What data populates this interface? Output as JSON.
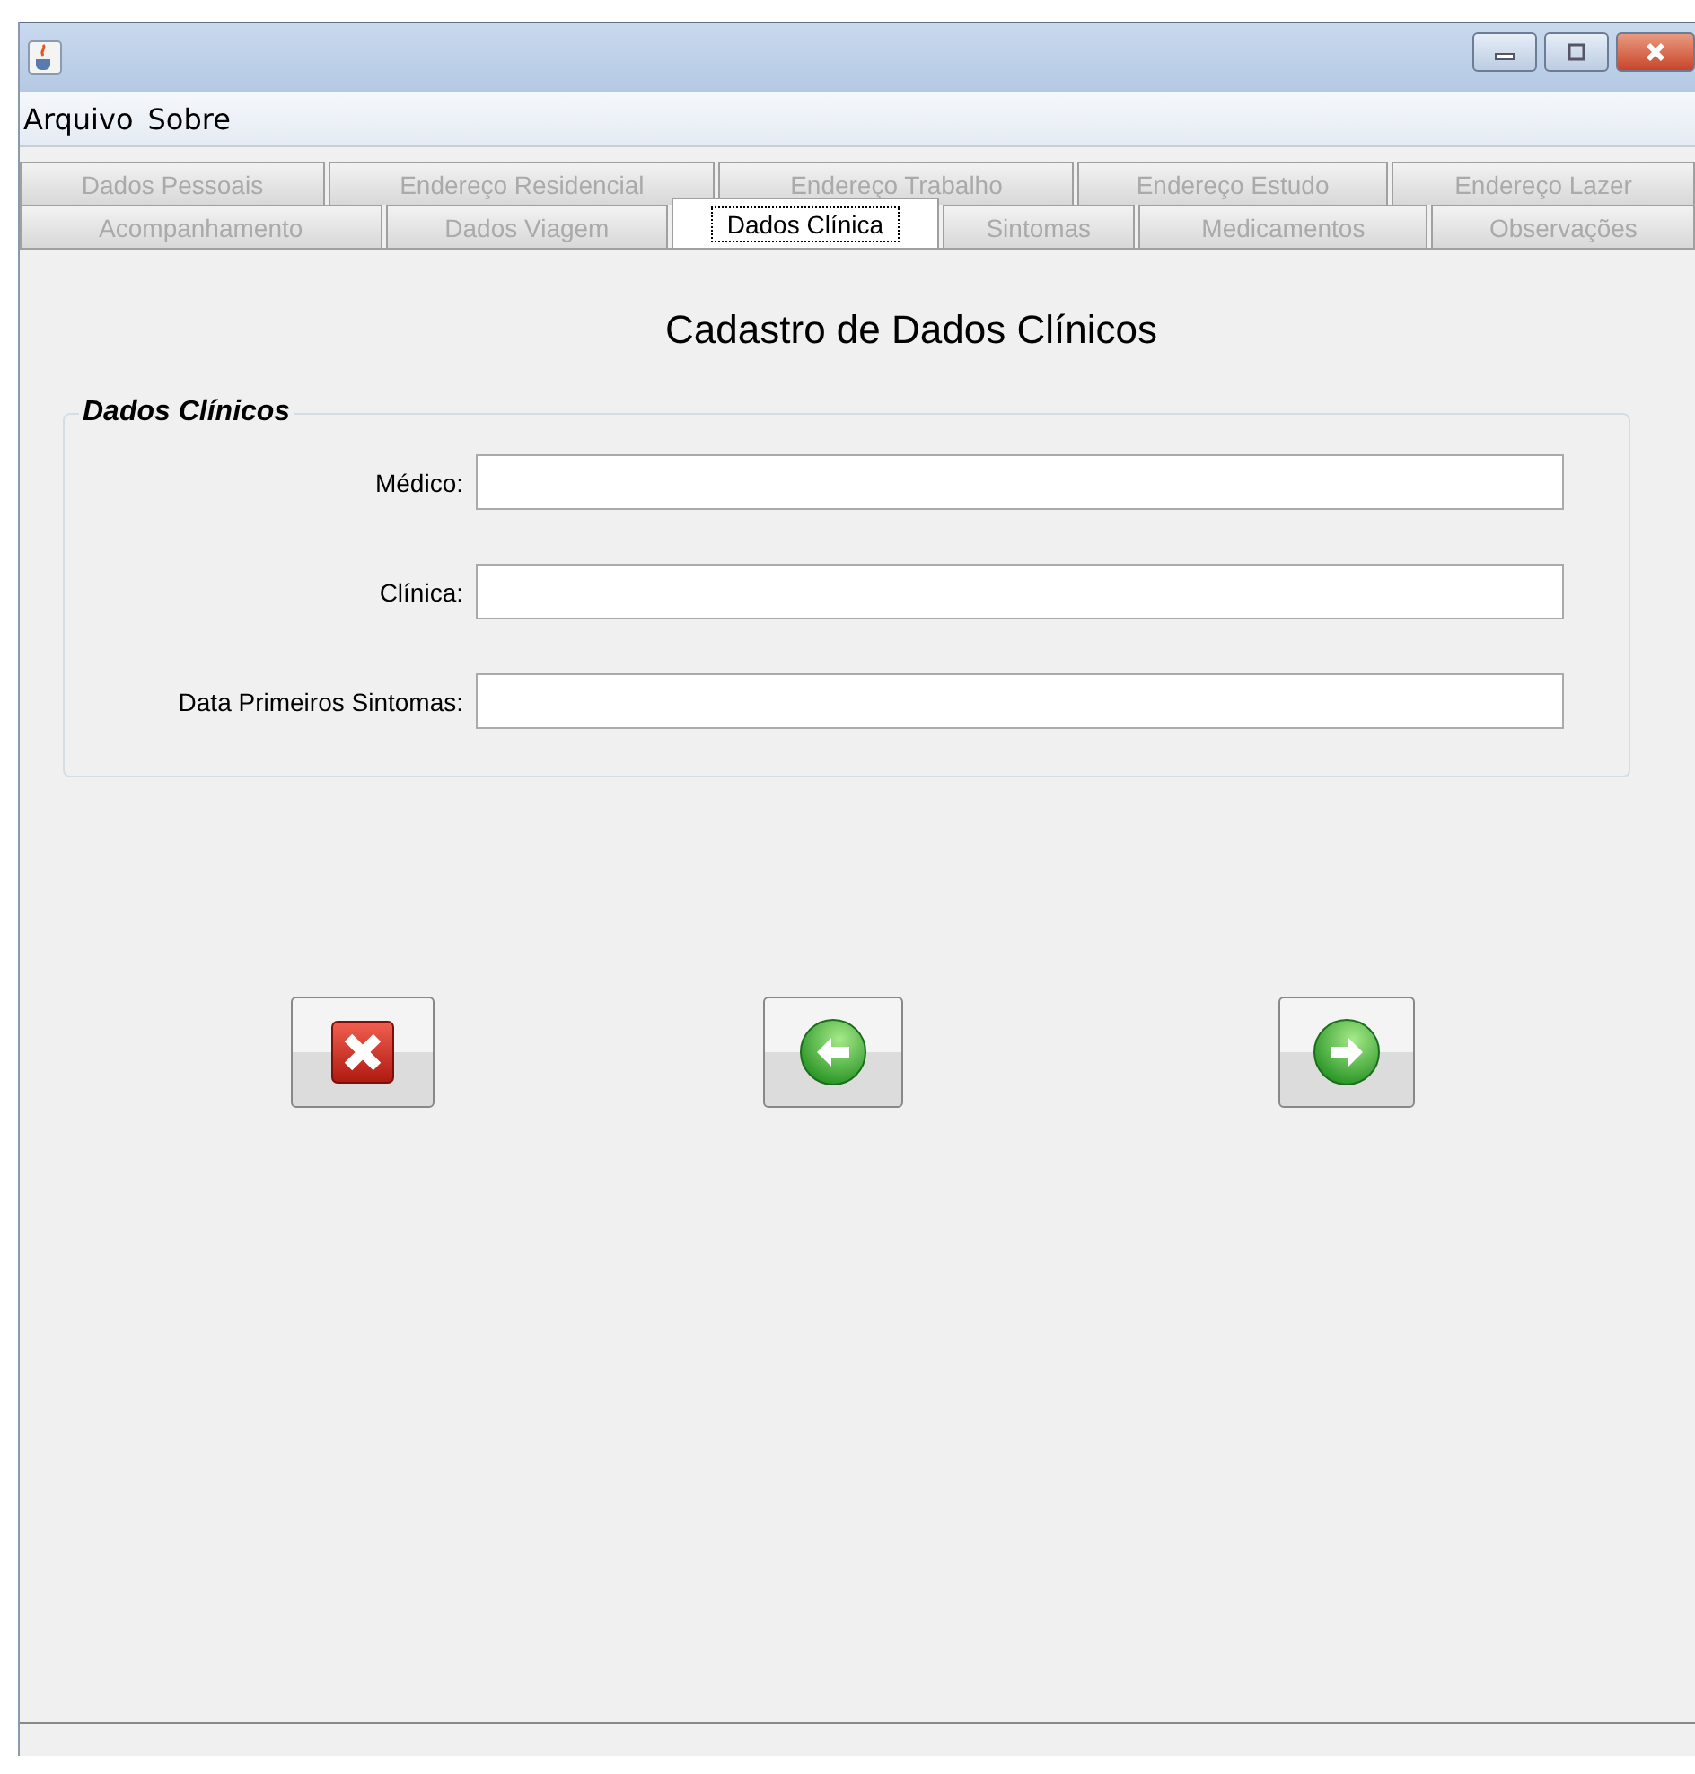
{
  "menu": [
    "Arquivo",
    "Sobre"
  ],
  "tab_rows": [
    [
      {
        "label": "Dados Pessoais",
        "selected": false
      },
      {
        "label": "Endereço Residencial",
        "selected": false
      },
      {
        "label": "Endereço Trabalho",
        "selected": false
      },
      {
        "label": "Endereço Estudo",
        "selected": false
      },
      {
        "label": "Endereço Lazer",
        "selected": false
      }
    ],
    [
      {
        "label": "Acompanhamento",
        "selected": false
      },
      {
        "label": "Dados Viagem",
        "selected": false
      },
      {
        "label": "Dados Clínica",
        "selected": true
      },
      {
        "label": "Sintomas",
        "selected": false
      },
      {
        "label": "Medicamentos",
        "selected": false
      },
      {
        "label": "Observações",
        "selected": false
      }
    ]
  ],
  "heading": "Cadastro de Dados Clínicos",
  "group": {
    "title": "Dados Clínicos",
    "fields": [
      {
        "label": "Médico:"
      },
      {
        "label": "Clínica:"
      },
      {
        "label": "Data Primeiros Sintomas:"
      }
    ]
  },
  "buttons": [
    {
      "kind": "cancel"
    },
    {
      "kind": "back"
    },
    {
      "kind": "forward"
    }
  ]
}
